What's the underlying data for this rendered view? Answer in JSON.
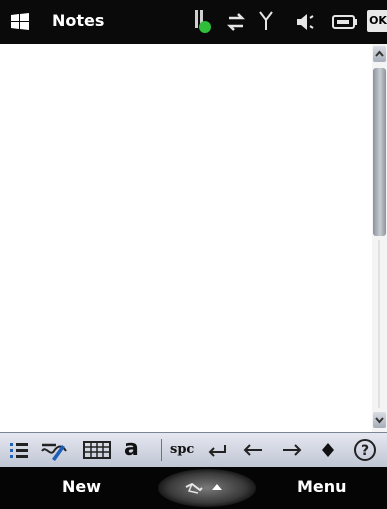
{
  "titlebar": {
    "title": "Notes",
    "ok_label": "OK",
    "icons": [
      "windows-start-icon",
      "battery-icon",
      "data-connection-icon",
      "signal-icon",
      "volume-icon",
      "battery-level-icon"
    ]
  },
  "input_toolbar": {
    "left_tools": [
      "list-format-icon",
      "handwriting-icon",
      "keypad-icon",
      "letter-a-icon"
    ],
    "spc_label": "spc",
    "right_tools": [
      "enter-icon",
      "left-arrow-icon",
      "right-arrow-icon",
      "diamond-icon",
      "help-icon"
    ]
  },
  "softkeys": {
    "left": "New",
    "right": "Menu",
    "center_icon": "input-panel-icon"
  },
  "colors": {
    "titlebar_bg": "#0a0a0a",
    "toolbar_bg": "#d3d8e3",
    "softkey_bg": "#050505",
    "battery_green": "#2fbf3a"
  }
}
